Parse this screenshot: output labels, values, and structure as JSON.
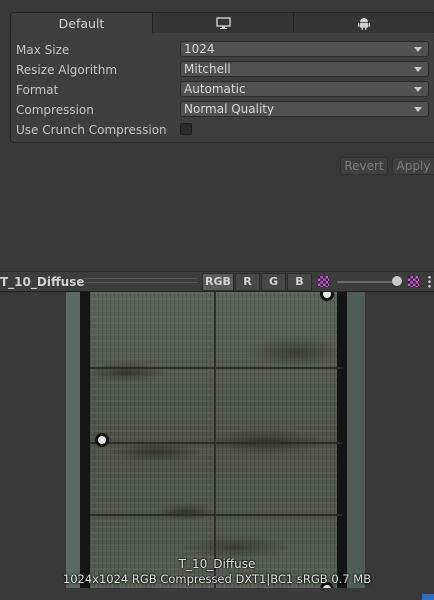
{
  "platform_tabs": {
    "default_label": "Default",
    "icons": [
      "monitor-icon",
      "android-icon"
    ]
  },
  "settings": {
    "max_size": {
      "label": "Max Size",
      "value": "1024"
    },
    "resize_algorithm": {
      "label": "Resize Algorithm",
      "value": "Mitchell"
    },
    "format": {
      "label": "Format",
      "value": "Automatic"
    },
    "compression": {
      "label": "Compression",
      "value": "Normal Quality"
    },
    "use_crunch": {
      "label": "Use Crunch Compression",
      "checked": false
    }
  },
  "actions": {
    "revert_label": "Revert",
    "apply_label": "Apply"
  },
  "preview": {
    "title": "T_10_Diffuse",
    "channels": [
      "RGB",
      "R",
      "G",
      "B"
    ],
    "active_channel": "RGB",
    "texture_name": "T_10_Diffuse",
    "texture_info": "1024x1024  RGB Compressed DXT1|BC1 sRGB   0.7 MB"
  },
  "colors": {
    "accent": "#2e6fbf",
    "panel": "#3e3e3e",
    "background": "#383838"
  }
}
